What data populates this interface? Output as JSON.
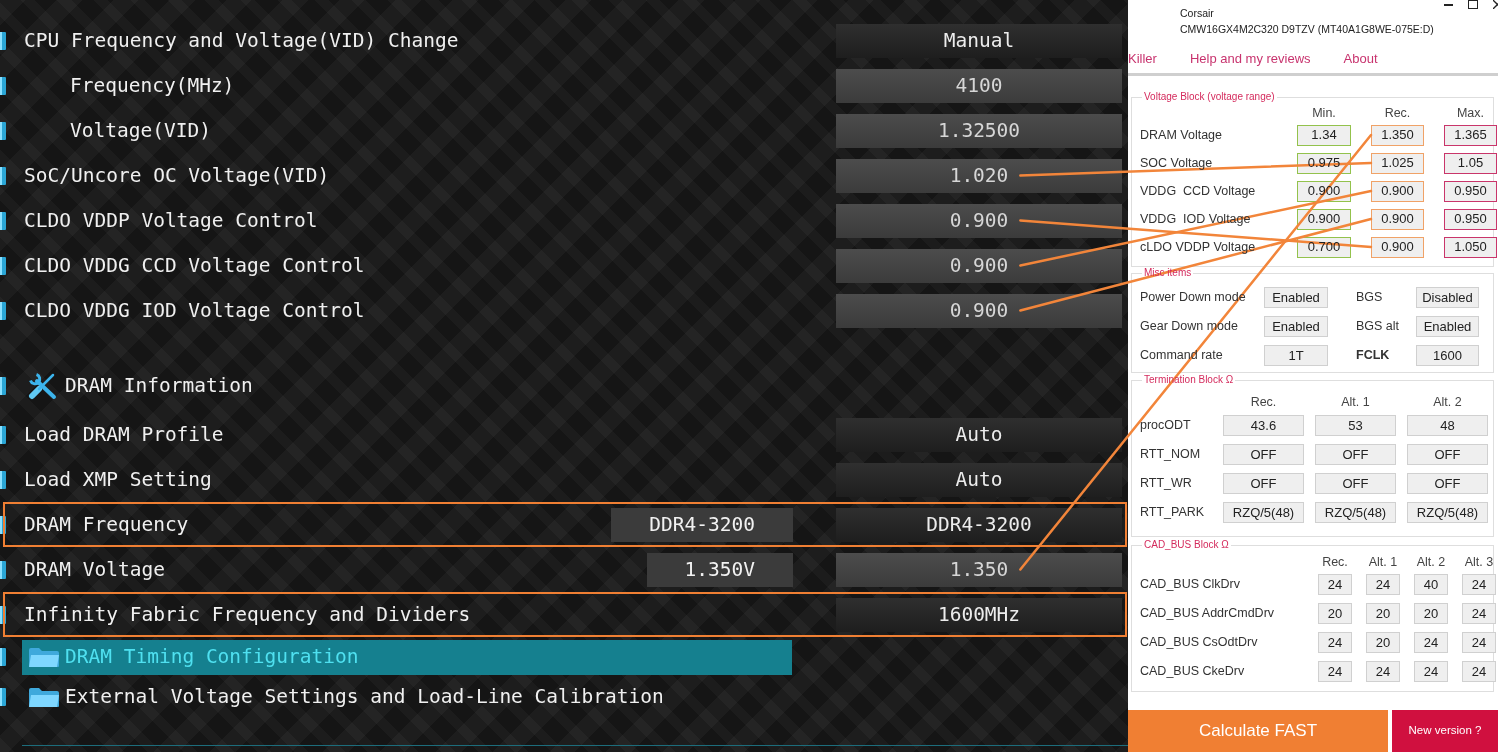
{
  "bios": {
    "rows": [
      {
        "kind": "setting",
        "label": "CPU Frequency and Voltage(VID) Change",
        "field": {
          "kind": "select",
          "text": "Manual"
        },
        "highlighted": false,
        "selected": false,
        "children": [
          {
            "kind": "setting",
            "label": "Frequency(MHz)",
            "field": {
              "kind": "number",
              "text": "4100"
            },
            "highlighted": false,
            "selected": false
          },
          {
            "kind": "setting",
            "label": "Voltage(VID)",
            "field": {
              "kind": "number",
              "text": "1.32500"
            },
            "highlighted": false,
            "selected": false
          }
        ]
      },
      {
        "kind": "setting",
        "label": "SoC/Uncore OC Voltage(VID)",
        "field": {
          "kind": "number",
          "text": "1.020"
        },
        "highlighted": false,
        "selected": false
      },
      {
        "kind": "setting",
        "label": "CLDO VDDP Voltage Control",
        "field": {
          "kind": "number",
          "text": "0.900"
        },
        "highlighted": false,
        "selected": false
      },
      {
        "kind": "setting",
        "label": "CLDO VDDG CCD Voltage Control",
        "field": {
          "kind": "number",
          "text": "0.900"
        },
        "highlighted": false,
        "selected": false
      },
      {
        "kind": "setting",
        "label": "CLDO VDDG IOD Voltage Control",
        "field": {
          "kind": "number",
          "text": "0.900"
        },
        "highlighted": false,
        "selected": false
      },
      {
        "kind": "section",
        "label": "DRAM Information",
        "selected": false
      },
      {
        "kind": "setting",
        "label": "Load DRAM Profile",
        "field": {
          "kind": "select",
          "text": "Auto"
        },
        "highlighted": false,
        "selected": false
      },
      {
        "kind": "setting",
        "label": "Load XMP Setting",
        "field": {
          "kind": "select",
          "text": "Auto"
        },
        "highlighted": false,
        "selected": false
      },
      {
        "kind": "setting",
        "label": "DRAM Frequency",
        "current": "DDR4-3200",
        "field": {
          "kind": "select",
          "text": "DDR4-3200"
        },
        "highlighted": true,
        "selected": false
      },
      {
        "kind": "setting",
        "label": "DRAM Voltage",
        "current": "1.350V",
        "field": {
          "kind": "number",
          "text": "1.350"
        },
        "highlighted": false,
        "selected": false
      },
      {
        "kind": "setting",
        "label": "Infinity Fabric Frequency and Dividers",
        "field": {
          "kind": "select",
          "text": "1600MHz"
        },
        "highlighted": true,
        "selected": false
      },
      {
        "kind": "folder",
        "label": "DRAM Timing Configuration",
        "selected": true
      },
      {
        "kind": "folder",
        "label": "External Voltage Settings and Load-Line Calibration",
        "selected": false
      }
    ]
  },
  "calculator": {
    "title_lines": [
      "Corsair",
      "CMW16GX4M2C320 D9TZV (MT40A1G8WE-075E:D)"
    ],
    "menu": [
      "Killer",
      "Help and my reviews",
      "About"
    ],
    "voltage_block": {
      "legend": "Voltage Block (voltage range)",
      "columns": [
        "Min.",
        "Rec.",
        "Max."
      ],
      "rows": [
        {
          "label": "DRAM Voltage",
          "min": "1.34",
          "rec": "1.350",
          "max": "1.365"
        },
        {
          "label": "SOC Voltage",
          "min": "0.975",
          "rec": "1.025",
          "max": "1.05"
        },
        {
          "label": "VDDG  CCD Voltage",
          "min": "0.900",
          "rec": "0.900",
          "max": "0.950"
        },
        {
          "label": "VDDG  IOD Voltage",
          "min": "0.900",
          "rec": "0.900",
          "max": "0.950"
        },
        {
          "label": "cLDO VDDP Voltage",
          "min": "0.700",
          "rec": "0.900",
          "max": "1.050"
        }
      ]
    },
    "misc_items": {
      "legend": "Misc items",
      "items": [
        {
          "label": "Power Down mode",
          "value": "Enabled",
          "bold": false
        },
        {
          "label": "BGS",
          "value": "Disabled",
          "bold": false
        },
        {
          "label": "Gear Down mode",
          "value": "Enabled",
          "bold": false
        },
        {
          "label": "BGS alt",
          "value": "Enabled",
          "bold": false
        },
        {
          "label": "Command rate",
          "value": "1T",
          "bold": false
        },
        {
          "label": "FCLK",
          "value": "1600",
          "bold": true
        }
      ]
    },
    "termination_block": {
      "legend": "Termination Block Ω",
      "columns": [
        "Rec.",
        "Alt. 1",
        "Alt. 2"
      ],
      "rows": [
        {
          "label": "procODT",
          "values": [
            "43.6",
            "53",
            "48"
          ]
        },
        {
          "label": "RTT_NOM",
          "values": [
            "OFF",
            "OFF",
            "OFF"
          ]
        },
        {
          "label": "RTT_WR",
          "values": [
            "OFF",
            "OFF",
            "OFF"
          ]
        },
        {
          "label": "RTT_PARK",
          "values": [
            "RZQ/5(48)",
            "RZQ/5(48)",
            "RZQ/5(48)"
          ]
        }
      ]
    },
    "cad_bus_block": {
      "legend": "CAD_BUS Block Ω",
      "columns": [
        "Rec.",
        "Alt. 1",
        "Alt. 2",
        "Alt. 3"
      ],
      "rows": [
        {
          "label": "CAD_BUS ClkDrv",
          "values": [
            "24",
            "24",
            "40",
            "24"
          ]
        },
        {
          "label": "CAD_BUS AddrCmdDrv",
          "values": [
            "20",
            "20",
            "20",
            "24"
          ]
        },
        {
          "label": "CAD_BUS CsOdtDrv",
          "values": [
            "24",
            "20",
            "24",
            "24"
          ]
        },
        {
          "label": "CAD_BUS CkeDrv",
          "values": [
            "24",
            "24",
            "24",
            "24"
          ]
        }
      ]
    },
    "buttons": [
      {
        "label": "Calculate FAST",
        "kind": "primary"
      },
      {
        "label": "New version ?",
        "kind": "secondary"
      }
    ]
  },
  "annotation_lines": [
    {
      "kind": "connector"
    },
    {
      "kind": "connector"
    },
    {
      "kind": "connector"
    },
    {
      "kind": "connector"
    },
    {
      "kind": "connector"
    }
  ]
}
